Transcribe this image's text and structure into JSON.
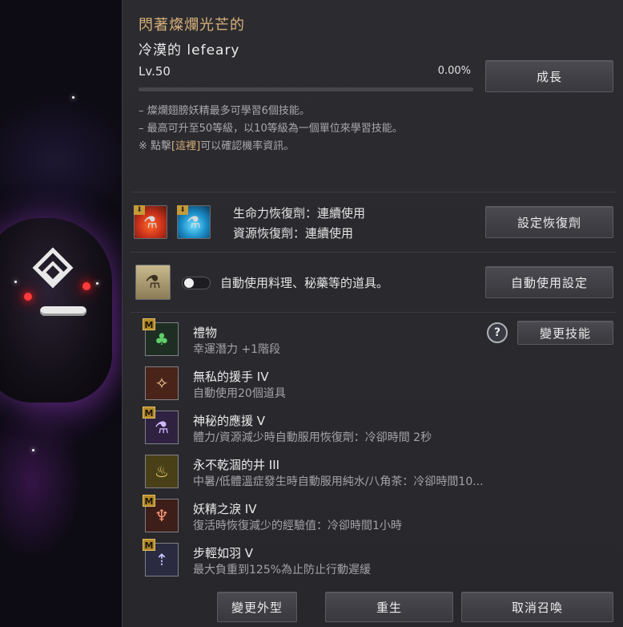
{
  "pet": {
    "title_prefix": "閃著燦爛光芒的",
    "name": "冷漠的 lefeary",
    "level": "Lv.50",
    "exp_percent": "0.00%",
    "exp_fraction": 0.0
  },
  "buttons": {
    "grow": "成長",
    "set_recovery": "設定恢復劑",
    "auto_use_settings": "自動使用設定",
    "change_skill": "變更技能",
    "change_appearance": "變更外型",
    "rebirth": "重生",
    "cancel_summon": "取消召喚"
  },
  "notes": {
    "line1": "– 燦爛翅膀妖精最多可學習6個技能。",
    "line2": "– 最高可升至50等級，以10等級為一個單位來學習技能。",
    "line3_prefix": "※ 點擊",
    "line3_link": "[這裡]",
    "line3_suffix": "可以確認機率資訊。"
  },
  "recovery": {
    "hp_label": "生命力恢復劑：連續使用",
    "resource_label": "資源恢復劑：連續使用"
  },
  "auto_use": {
    "label": "自動使用料理、秘藥等的道具。",
    "enabled": false
  },
  "skills": [
    {
      "name": "禮物",
      "desc": "幸運潛力 +1階段",
      "badge": "M",
      "icon": "clover-icon"
    },
    {
      "name": "無私的援手 IV",
      "desc": "自動使用20個道具",
      "badge": "",
      "icon": "fairy-wing-icon"
    },
    {
      "name": "神秘的應援 V",
      "desc": "體力/資源減少時自動服用恢復劑：冷卻時間 2秒",
      "badge": "M",
      "icon": "potions-icon"
    },
    {
      "name": "永不乾涸的井 III",
      "desc": "中暑/低體溫症發生時自動服用純水/八角茶：冷卻時間10...",
      "badge": "",
      "icon": "tea-bowl-icon"
    },
    {
      "name": "妖精之淚 IV",
      "desc": "復活時恢復減少的經驗值：冷卻時間1小時",
      "badge": "M",
      "icon": "tear-vase-icon"
    },
    {
      "name": "步輕如羽 V",
      "desc": "最大負重到125%為止防止行動遲緩",
      "badge": "M",
      "icon": "weight-arrow-icon"
    }
  ],
  "icons": {
    "help": "?"
  },
  "colors": {
    "accent_gold": "#d9b07a",
    "panel_bg": "#2c2c30"
  }
}
